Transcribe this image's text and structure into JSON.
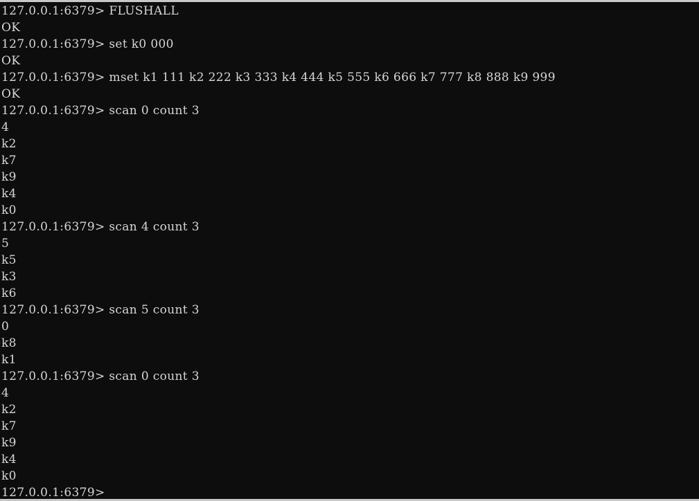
{
  "terminal": {
    "app": "redis-cli",
    "colors": {
      "background": "#0d0d0d",
      "foreground": "#d6d6d6",
      "border": "#c8c8c8"
    },
    "prompt": "127.0.0.1:6379>",
    "lines": [
      {
        "type": "prompt",
        "prompt": "127.0.0.1:6379>",
        "command": " FLUSHALL"
      },
      {
        "type": "output",
        "text": "OK"
      },
      {
        "type": "prompt",
        "prompt": "127.0.0.1:6379>",
        "command": " set k0 000"
      },
      {
        "type": "output",
        "text": "OK"
      },
      {
        "type": "prompt",
        "prompt": "127.0.0.1:6379>",
        "command": " mset k1 111 k2 222 k3 333 k4 444 k5 555 k6 666 k7 777 k8 888 k9 999"
      },
      {
        "type": "output",
        "text": "OK"
      },
      {
        "type": "prompt",
        "prompt": "127.0.0.1:6379>",
        "command": " scan 0 count 3"
      },
      {
        "type": "output",
        "text": "4"
      },
      {
        "type": "output",
        "text": "k2"
      },
      {
        "type": "output",
        "text": "k7"
      },
      {
        "type": "output",
        "text": "k9"
      },
      {
        "type": "output",
        "text": "k4"
      },
      {
        "type": "output",
        "text": "k0"
      },
      {
        "type": "prompt",
        "prompt": "127.0.0.1:6379>",
        "command": " scan 4 count 3"
      },
      {
        "type": "output",
        "text": "5"
      },
      {
        "type": "output",
        "text": "k5"
      },
      {
        "type": "output",
        "text": "k3"
      },
      {
        "type": "output",
        "text": "k6"
      },
      {
        "type": "prompt",
        "prompt": "127.0.0.1:6379>",
        "command": " scan 5 count 3"
      },
      {
        "type": "output",
        "text": "0"
      },
      {
        "type": "output",
        "text": "k8"
      },
      {
        "type": "output",
        "text": "k1"
      },
      {
        "type": "prompt",
        "prompt": "127.0.0.1:6379>",
        "command": " scan 0 count 3"
      },
      {
        "type": "output",
        "text": "4"
      },
      {
        "type": "output",
        "text": "k2"
      },
      {
        "type": "output",
        "text": "k7"
      },
      {
        "type": "output",
        "text": "k9"
      },
      {
        "type": "output",
        "text": "k4"
      },
      {
        "type": "output",
        "text": "k0"
      },
      {
        "type": "prompt",
        "prompt": "127.0.0.1:6379>",
        "command": ""
      }
    ]
  }
}
